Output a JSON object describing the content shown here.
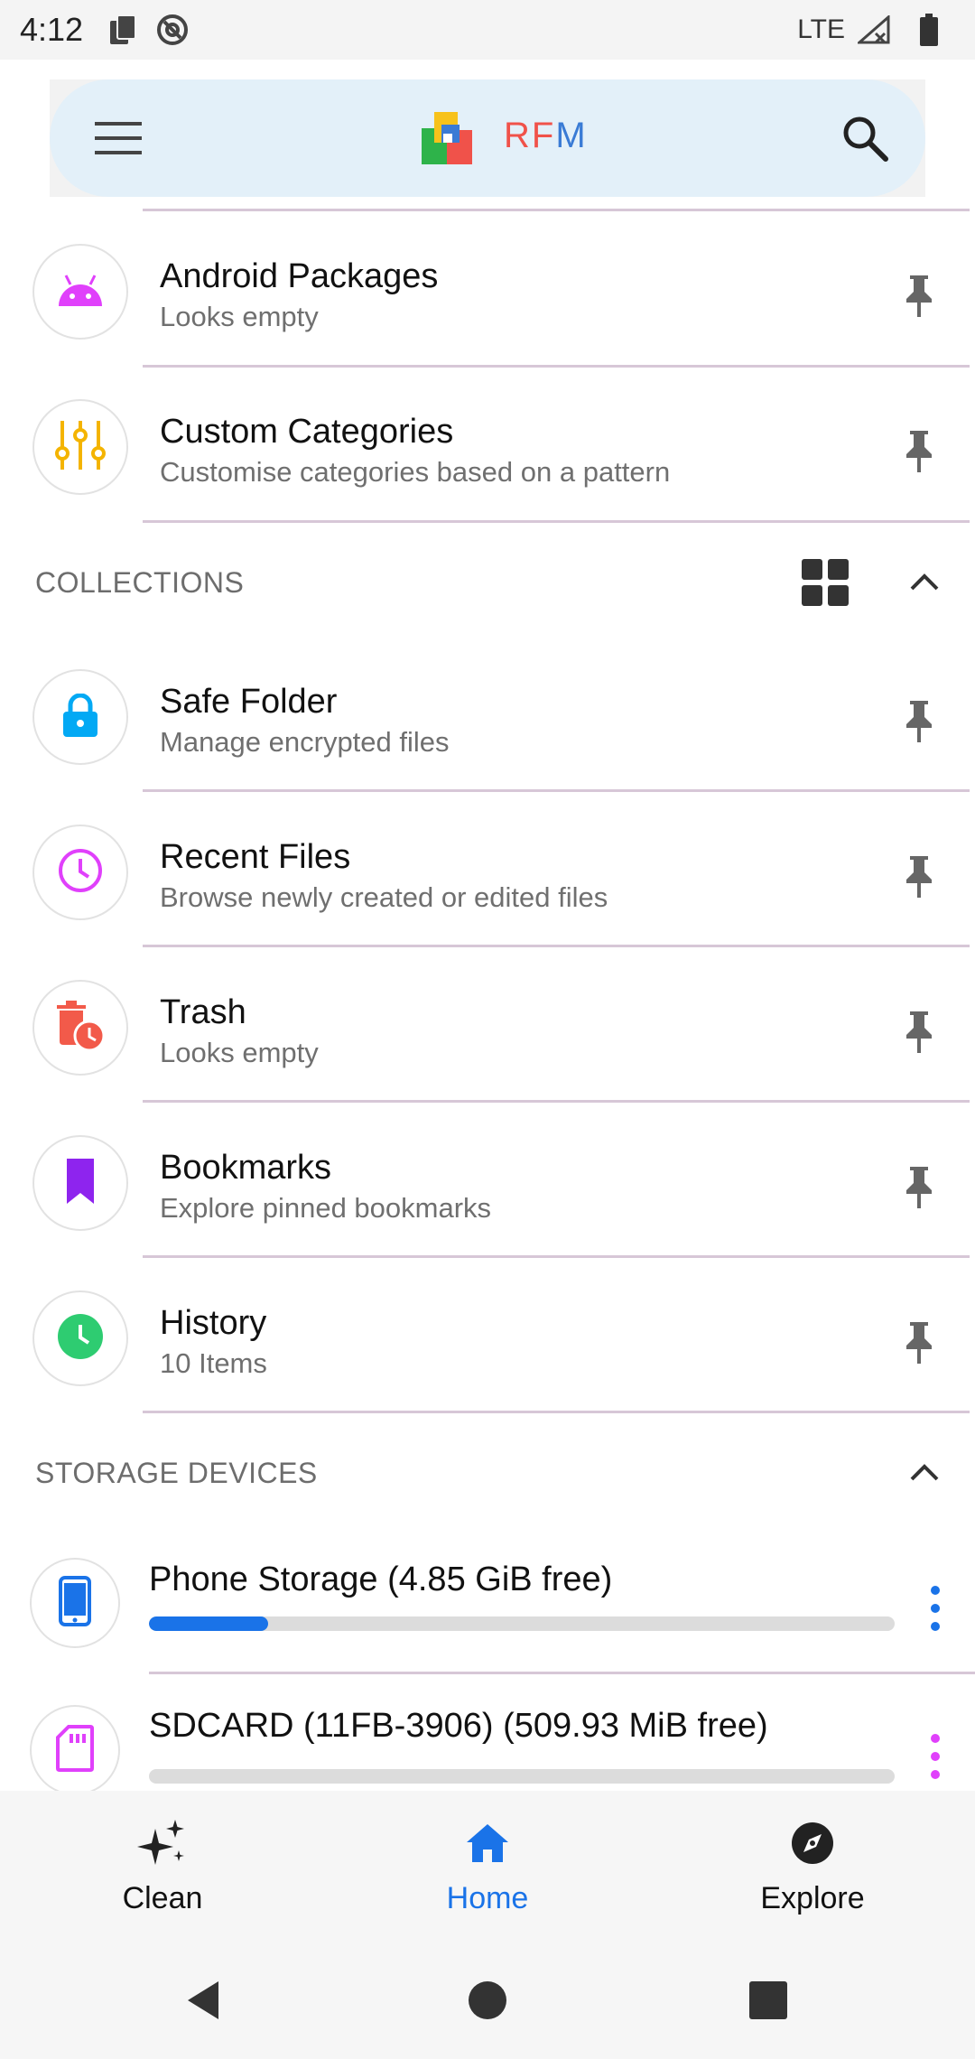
{
  "status_bar": {
    "time": "4:12",
    "network": "LTE"
  },
  "app_bar": {
    "brand_r": "R",
    "brand_f": "F",
    "brand_m": "M"
  },
  "categories": [
    {
      "title": "Android Packages",
      "subtitle": "Looks empty",
      "icon": "android-icon",
      "color": "#e040fb"
    },
    {
      "title": "Custom Categories",
      "subtitle": "Customise categories based on a pattern",
      "icon": "tune-sliders-icon",
      "color": "#f4b400"
    }
  ],
  "collections": {
    "header": "COLLECTIONS",
    "items": [
      {
        "title": "Safe Folder",
        "subtitle": "Manage encrypted files",
        "icon": "lock-icon",
        "color": "#03a9f4"
      },
      {
        "title": "Recent Files",
        "subtitle": "Browse newly created or edited files",
        "icon": "clock-icon",
        "color": "#e040fb"
      },
      {
        "title": "Trash",
        "subtitle": "Looks empty",
        "icon": "trash-icon",
        "color": "#f25a4a"
      },
      {
        "title": "Bookmarks",
        "subtitle": "Explore pinned bookmarks",
        "icon": "bookmark-icon",
        "color": "#8e24ee"
      },
      {
        "title": "History",
        "subtitle": "10 Items",
        "icon": "history-icon",
        "color": "#2ecc71"
      }
    ]
  },
  "storage": {
    "header": "STORAGE DEVICES",
    "devices": [
      {
        "title": "Phone Storage (4.85 GiB free)",
        "used_fraction": 0.16,
        "color": "#1a73e8",
        "icon": "phone-icon"
      },
      {
        "title": "SDCARD (11FB-3906) (509.93 MiB free)",
        "used_fraction": 0.0,
        "color": "#e040fb",
        "icon": "sd-card-icon"
      }
    ]
  },
  "bottom_nav": [
    {
      "label": "Clean",
      "icon": "sparkle-icon",
      "active": false
    },
    {
      "label": "Home",
      "icon": "home-icon",
      "active": true
    },
    {
      "label": "Explore",
      "icon": "compass-icon",
      "active": false
    }
  ]
}
